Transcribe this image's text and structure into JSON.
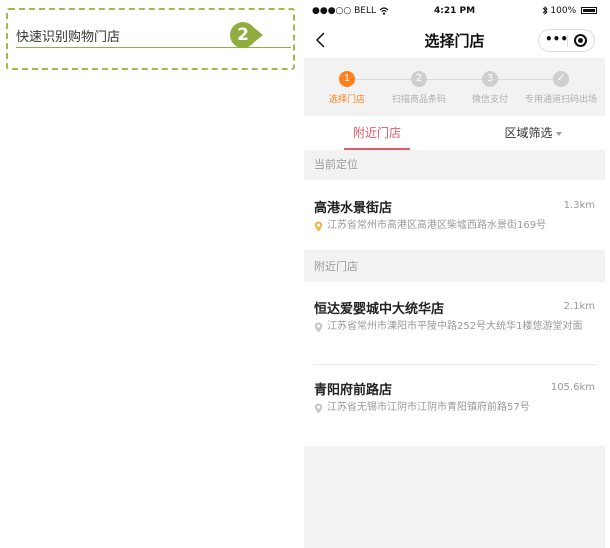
{
  "annotation": {
    "text": "快速识别购物门店",
    "badge": "2"
  },
  "status_bar": {
    "carrier": "●●●○○ BELL",
    "time": "4:21 PM",
    "battery": "100%"
  },
  "nav": {
    "title": "选择门店",
    "more": "•••"
  },
  "steps": [
    {
      "number": "1",
      "label": "选择门店",
      "active": true
    },
    {
      "number": "2",
      "label": "扫描商品条码",
      "active": false
    },
    {
      "number": "3",
      "label": "微信支付",
      "active": false
    },
    {
      "number": "✓",
      "label": "专用通道扫码出场",
      "active": false
    }
  ],
  "tabs": {
    "nearby": "附近门店",
    "area_filter": "区域筛选"
  },
  "current_location": {
    "header": "当前定位",
    "store": {
      "name": "高港水景街店",
      "distance": "1.3km",
      "address": "江苏省常州市高港区高港区柴墟西路水景街169号"
    }
  },
  "nearby": {
    "header": "附近门店",
    "stores": [
      {
        "name": "恒达爱婴城中大统华店",
        "distance": "2.1km",
        "address": "江苏省常州市溧阳市平陵中路252号大统华1楼悠游堂对面"
      },
      {
        "name": "青阳府前路店",
        "distance": "105.6km",
        "address": "江苏省无锡市江阴市江阴市青阳镇府前路57号"
      }
    ]
  },
  "colors": {
    "accent_orange": "#ff7f1a",
    "tab_pink": "#e05a6a",
    "annotation_green": "#8fae3f",
    "pin_current": "#e8b84a",
    "pin_other": "#c8c8c8"
  },
  "icons": {
    "back": "chevron-left-icon",
    "more": "more-dots-icon",
    "target": "target-icon",
    "pin": "map-pin-icon",
    "bluetooth": "bluetooth-icon",
    "wifi": "wifi-icon"
  }
}
